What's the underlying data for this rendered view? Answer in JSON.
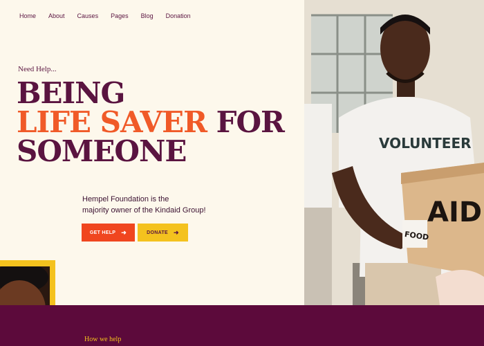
{
  "nav": {
    "items": [
      "Home",
      "About",
      "Causes",
      "Pages",
      "Blog",
      "Donation"
    ]
  },
  "hero": {
    "eyebrow": "Need Help...",
    "line1": "BEING",
    "line2_accent": "LIFE SAVER",
    "line2_rest": " FOR",
    "line3": "SOMEONE",
    "description_line1": "Hempel Foundation is the",
    "description_line2": "majority owner of the Kindaid Group!",
    "get_help_label": "GET HELP",
    "donate_label": "DONATE"
  },
  "photo": {
    "shirt_text": "VOLUNTEER",
    "box_text_big": "AID",
    "box_text_small": "FOOD"
  },
  "section": {
    "eyebrow": "How we help"
  },
  "colors": {
    "background": "#fdf8ec",
    "primary": "#5a1440",
    "accent": "#f05a28",
    "yellow": "#f4c21e",
    "band": "#5c0a3b"
  }
}
